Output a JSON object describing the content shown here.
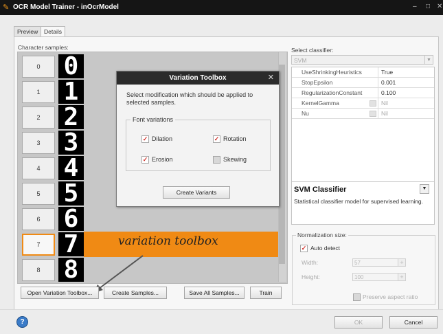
{
  "window": {
    "title": "OCR Model Trainer - inOcrModel",
    "controls": [
      "–",
      "□",
      "✕"
    ]
  },
  "tabs": [
    {
      "label": "Preview",
      "active": false
    },
    {
      "label": "Details",
      "active": true
    }
  ],
  "samples": {
    "label": "Character samples:",
    "items": [
      {
        "index": "0",
        "glyph": "0"
      },
      {
        "index": "1",
        "glyph": "1"
      },
      {
        "index": "2",
        "glyph": "2"
      },
      {
        "index": "3",
        "glyph": "3"
      },
      {
        "index": "4",
        "glyph": "4"
      },
      {
        "index": "5",
        "glyph": "5"
      },
      {
        "index": "6",
        "glyph": "6"
      },
      {
        "index": "7",
        "glyph": "7",
        "selected": true
      },
      {
        "index": "8",
        "glyph": "8"
      }
    ]
  },
  "variation_dialog": {
    "title": "Variation Toolbox",
    "close": "✕",
    "description": "Select modification which should be applied to selected samples.",
    "group_title": "Font variations",
    "options": [
      {
        "label": "Dilation",
        "checked": true
      },
      {
        "label": "Rotation",
        "checked": true
      },
      {
        "label": "Erosion",
        "checked": true
      },
      {
        "label": "Skewing",
        "checked": false
      }
    ],
    "create_button": "Create Variants"
  },
  "annotation": {
    "text": "variation toolbox"
  },
  "buttons": {
    "open_variation": "Open Variation Toolbox...",
    "create_samples": "Create Samples...",
    "save_all": "Save All Samples...",
    "train": "Train",
    "ok": "OK",
    "cancel": "Cancel"
  },
  "classifier": {
    "label": "Select classifier:",
    "selected": "SVM",
    "params": [
      {
        "name": "UseShrinkingHeuristics",
        "value": "True",
        "enabled": true
      },
      {
        "name": "StopEpsilon",
        "value": "0.001",
        "enabled": true
      },
      {
        "name": "RegularizationConstant",
        "value": "0.100",
        "enabled": true
      },
      {
        "name": "KernelGamma",
        "value": "Nil",
        "enabled": false
      },
      {
        "name": "Nu",
        "value": "Nil",
        "enabled": false
      }
    ],
    "description_title": "SVM Classifier",
    "description_text": "Statistical classifier model for supervised learning."
  },
  "normalization": {
    "title": "Normalization size:",
    "auto_detect_label": "Auto detect",
    "auto_detect": true,
    "width_label": "Width:",
    "width_value": "57",
    "height_label": "Height:",
    "height_value": "100",
    "preserve_label": "Preserve aspect ratio",
    "preserve": false
  },
  "colors": {
    "highlight": "#f08a14",
    "titlebar": "#151515",
    "checkmark": "#d0302a"
  },
  "icons": {
    "help": "?",
    "app": "app-logo"
  }
}
